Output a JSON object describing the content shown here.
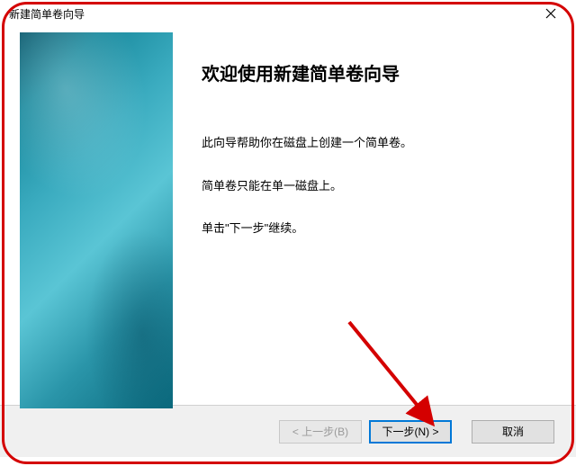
{
  "window": {
    "title": "新建简单卷向导"
  },
  "content": {
    "heading": "欢迎使用新建简单卷向导",
    "line1": "此向导帮助你在磁盘上创建一个简单卷。",
    "line2": "简单卷只能在单一磁盘上。",
    "line3": "单击\"下一步\"继续。"
  },
  "buttons": {
    "back": "< 上一步(B)",
    "next": "下一步(N) >",
    "cancel": "取消"
  }
}
